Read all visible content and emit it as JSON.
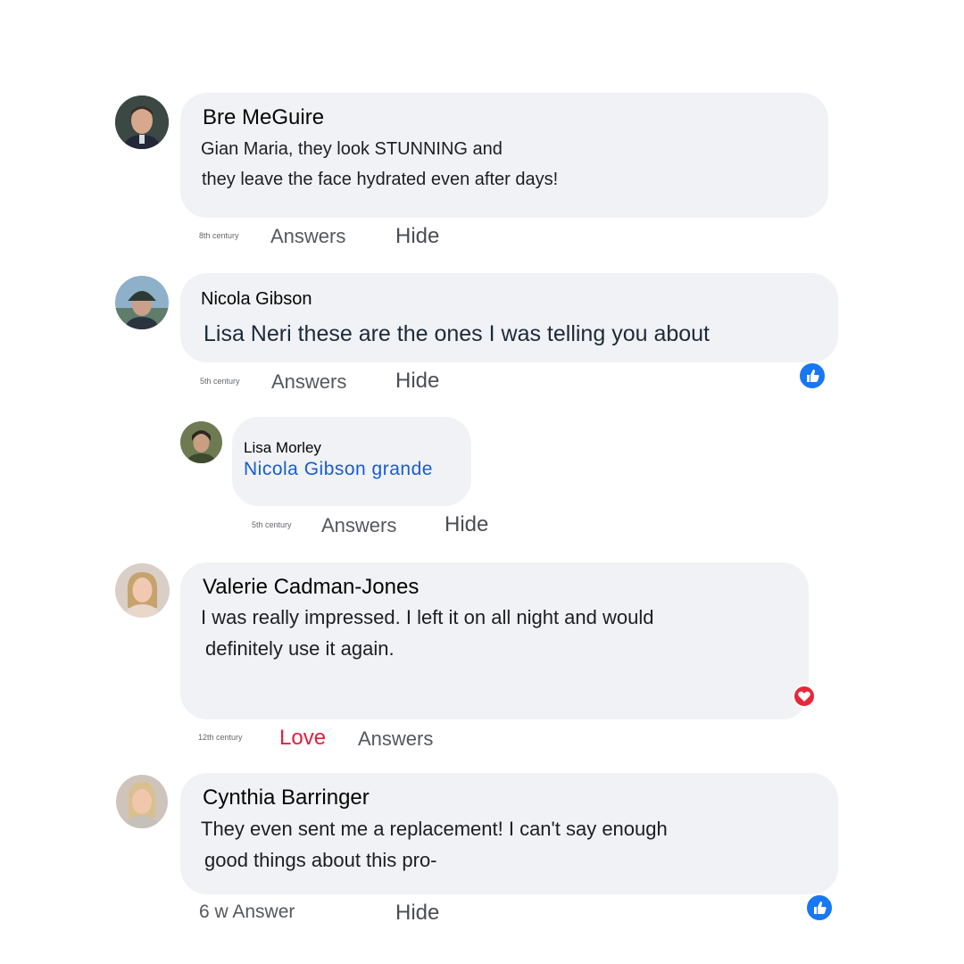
{
  "colors": {
    "bubble": "#f0f2f5",
    "link_blue": "#1a5bd1",
    "like_blue": "#1877f2",
    "love_red": "#e41e3f",
    "meta_gray": "#65676b"
  },
  "comments": [
    {
      "author": "Bre MeGuire",
      "line1": "Gian Maria, they look STUNNING and",
      "line2": "they leave the face hydrated even after days!",
      "time": "8th century",
      "answers": "Answers",
      "hide": "Hide",
      "avatar_icon": "avatar-man-icon"
    },
    {
      "author": "Nicola Gibson",
      "line1": "Lisa Neri these are the ones I was telling you about",
      "time": "5th century",
      "answers": "Answers",
      "hide": "Hide",
      "reaction_icon": "like-icon"
    },
    {
      "author": "Lisa Morley",
      "mention": "Nicola Gibson grande",
      "time": "5th century",
      "answers": "Answers",
      "hide": "Hide"
    },
    {
      "author": "Valerie Cadman-Jones",
      "line1": "I was really impressed. I left it on all night and would",
      "line2": "definitely use it again.",
      "time": "12th century",
      "love": "Love",
      "answers": "Answers",
      "reaction_icon": "love-icon"
    },
    {
      "author": "Cynthia Barringer",
      "line1": "They even sent me a replacement! I can't say enough",
      "line2": "good things about this pro-",
      "time_answer": "6 w Answer",
      "hide": "Hide",
      "reaction_icon": "like-icon"
    }
  ]
}
